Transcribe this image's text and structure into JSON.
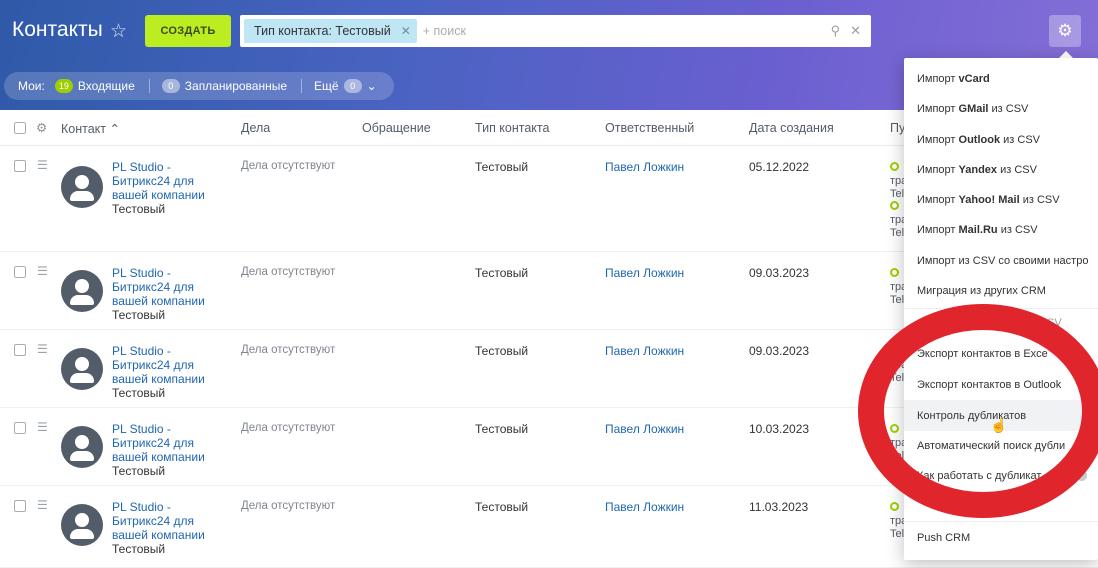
{
  "header": {
    "title": "Контакты",
    "create_label": "СОЗДАТЬ",
    "filter_chip": "Тип контакта: Тестовый",
    "search_placeholder": "+ поиск"
  },
  "counters": {
    "mine_label": "Мои:",
    "incoming_count": "19",
    "incoming_label": "Входящие",
    "planned_count": "0",
    "planned_label": "Запланированные",
    "more_label": "Ещё",
    "more_count": "0"
  },
  "columns": [
    "Контакт",
    "Дела",
    "Обращение",
    "Тип контакта",
    "Ответственный",
    "Дата создания",
    "Пу"
  ],
  "rows": [
    {
      "name1": "PL Studio -",
      "name2": "Битрикс24 для",
      "name3": "вашей компании",
      "sub": "Тестовый",
      "deals": "Дела отсутствуют",
      "type": "Тестовый",
      "resp": "Павел Ложкин",
      "date": "05.12.2022",
      "src": [
        "тра",
        "Tel",
        "тра",
        "Tel"
      ]
    },
    {
      "name1": "PL Studio -",
      "name2": "Битрикс24 для",
      "name3": "вашей компании",
      "sub": "Тестовый",
      "deals": "Дела отсутствуют",
      "type": "Тестовый",
      "resp": "Павел Ложкин",
      "date": "09.03.2023",
      "src": [
        "тра",
        "Tel"
      ]
    },
    {
      "name1": "PL Studio -",
      "name2": "Битрикс24 для",
      "name3": "вашей компании",
      "sub": "Тестовый",
      "deals": "Дела отсутствуют",
      "type": "Тестовый",
      "resp": "Павел Ложкин",
      "date": "09.03.2023",
      "src": [
        "тра",
        "Tel"
      ]
    },
    {
      "name1": "PL Studio -",
      "name2": "Битрикс24 для",
      "name3": "вашей компании",
      "sub": "Тестовый",
      "deals": "Дела отсутствуют",
      "type": "Тестовый",
      "resp": "Павел Ложкин",
      "date": "10.03.2023",
      "src": [
        "тра",
        "Tel"
      ]
    },
    {
      "name1": "PL Studio -",
      "name2": "Битрикс24 для",
      "name3": "вашей компании",
      "sub": "Тестовый",
      "deals": "Дела отсутствуют",
      "type": "Тестовый",
      "resp": "Павел Ложкин",
      "date": "11.03.2023",
      "src": [
        "тра",
        "Tel"
      ]
    }
  ],
  "menu": {
    "items": [
      {
        "pre": "Импорт ",
        "bold": "vCard",
        "post": ""
      },
      {
        "pre": "Импорт ",
        "bold": "GMail",
        "post": " из CSV"
      },
      {
        "pre": "Импорт ",
        "bold": "Outlook",
        "post": " из CSV"
      },
      {
        "pre": "Импорт ",
        "bold": "Yandex",
        "post": " из CSV"
      },
      {
        "pre": "Импорт ",
        "bold": "Yahoo! Mail",
        "post": " из CSV"
      },
      {
        "pre": "Импорт ",
        "bold": "Mail.Ru",
        "post": " из CSV"
      },
      {
        "pre": "Импорт из CSV со своими настро",
        "bold": "",
        "post": ""
      },
      {
        "pre": "Миграция из других CRM",
        "bold": "",
        "post": ""
      },
      {
        "pre": "…SV",
        "bold": "",
        "post": ""
      },
      {
        "pre": "Экспорт контактов в Exce",
        "bold": "",
        "post": ""
      },
      {
        "pre": "Экспорт контактов в Outlook",
        "bold": "",
        "post": ""
      },
      {
        "pre": "Контроль дубликатов",
        "bold": "",
        "post": ""
      },
      {
        "pre": "Автоматический поиск дубли",
        "bold": "",
        "post": ""
      },
      {
        "pre": "Как работать с дубликат",
        "bold": "",
        "post": ""
      },
      {
        "pre": "",
        "bold": "",
        "post": ""
      },
      {
        "pre": "Push CRM",
        "bold": "",
        "post": ""
      }
    ]
  },
  "colors": {
    "accent_green": "#bbed21",
    "annotation_red": "#e0252c",
    "link_blue": "#2067b0"
  }
}
